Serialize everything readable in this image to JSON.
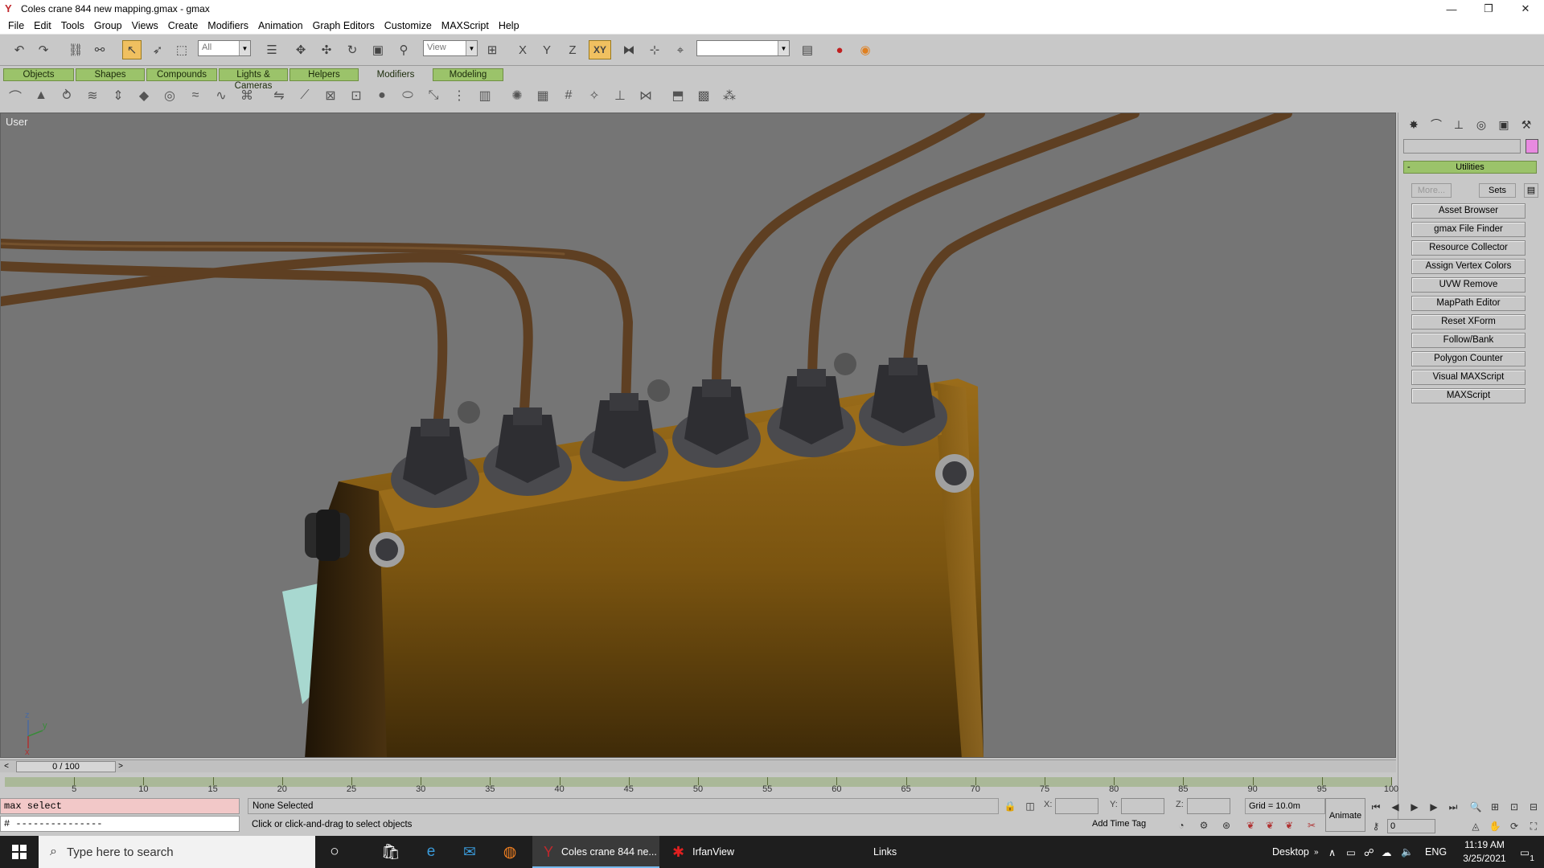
{
  "window": {
    "title": "Coles crane 844 new mapping.gmax - gmax",
    "controls": [
      "—",
      "❐",
      "✕"
    ]
  },
  "menubar": [
    "File",
    "Edit",
    "Tools",
    "Group",
    "Views",
    "Create",
    "Modifiers",
    "Animation",
    "Graph Editors",
    "Customize",
    "MAXScript",
    "Help"
  ],
  "toolbar": {
    "selection_filter": "All",
    "ref_coord": "View",
    "named_selection": "",
    "axis_x": "X",
    "axis_y": "Y",
    "axis_z": "Z",
    "axis_xy": "XY"
  },
  "tabs": [
    {
      "label": "Objects",
      "active": false
    },
    {
      "label": "Shapes",
      "active": false
    },
    {
      "label": "Compounds",
      "active": false
    },
    {
      "label": "Lights & Cameras",
      "active": false
    },
    {
      "label": "Helpers",
      "active": false
    },
    {
      "label": "Modifiers",
      "active": true
    },
    {
      "label": "Modeling",
      "active": false
    }
  ],
  "viewport": {
    "label": "User",
    "axis": {
      "x": "x",
      "y": "y",
      "z": "z"
    }
  },
  "command_panel": {
    "rollout_title": "Utilities",
    "rollout_toggle": "-",
    "more_label": "More...",
    "sets_label": "Sets",
    "utilities": [
      "Asset Browser",
      "gmax File Finder",
      "Resource Collector",
      "Assign Vertex Colors",
      "UVW Remove",
      "MapPath Editor",
      "Reset XForm",
      "Follow/Bank",
      "Polygon Counter",
      "Visual MAXScript",
      "MAXScript"
    ],
    "color_swatch": "#e88ae0"
  },
  "timeline": {
    "frame_readout": "0 / 100",
    "scroll_left": "<",
    "scroll_right": ">",
    "ticks": [
      "5",
      "10",
      "15",
      "20",
      "25",
      "30",
      "35",
      "40",
      "45",
      "50",
      "55",
      "60",
      "65",
      "70",
      "75",
      "80",
      "85",
      "90",
      "95",
      "100"
    ]
  },
  "status": {
    "maxscript_line1": "max select",
    "maxscript_line2": "# ---------------",
    "selection": "None Selected",
    "prompt": "Click or click-and-drag to select objects",
    "x_label": "X:",
    "y_label": "Y:",
    "z_label": "Z:",
    "grid": "Grid = 10.0m",
    "add_time_tag": "Add Time Tag",
    "animate": "Animate",
    "current_frame": "0"
  },
  "taskbar": {
    "search_placeholder": "Type here to search",
    "apps": [
      {
        "label": "Coles crane 844 ne...",
        "active": true
      },
      {
        "label": "IrfanView",
        "active": false
      }
    ],
    "links": "Links",
    "desktop": "Desktop",
    "language": "ENG",
    "time": "11:19 AM",
    "date": "3/25/2021",
    "notification_count": "1"
  },
  "colors": {
    "tab_green": "#9bc36a",
    "viewport_bg": "#757575",
    "object_body": "#8a5e14",
    "pipe": "#5e3f22",
    "nut": "#3a3a3e"
  }
}
